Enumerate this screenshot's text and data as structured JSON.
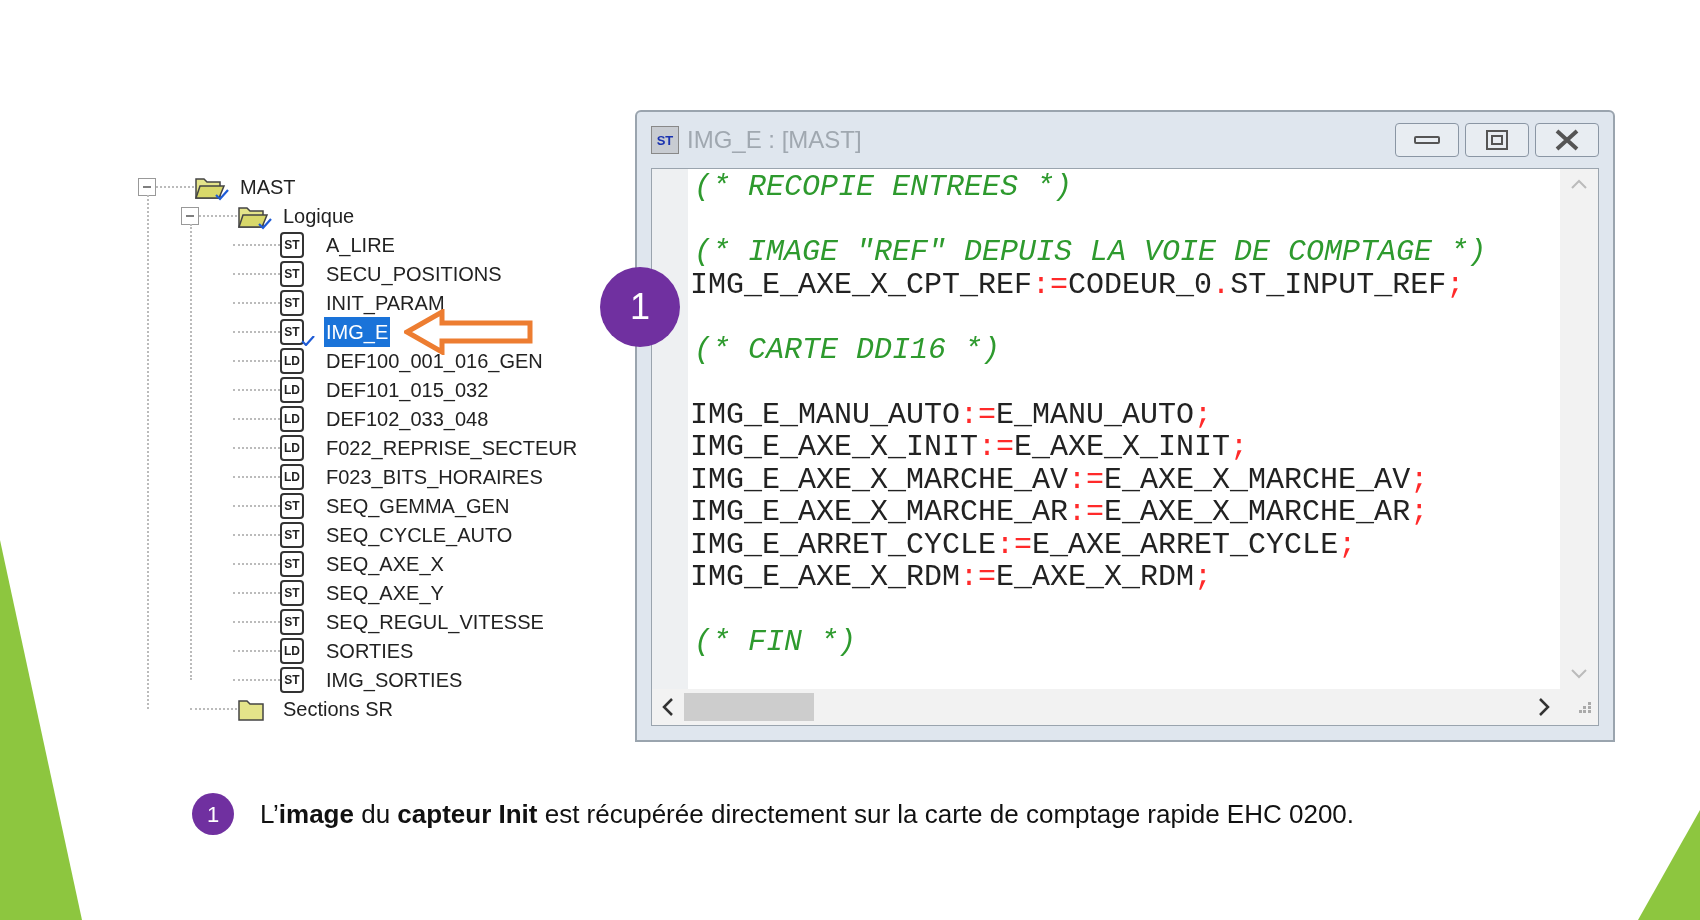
{
  "tree": [
    {
      "label": "MAST",
      "kind": "folder",
      "expanded": true,
      "marked": true,
      "selected": false,
      "children": [
        {
          "label": "Logique",
          "kind": "folder",
          "expanded": true,
          "marked": true,
          "selected": false,
          "children": [
            {
              "label": "A_LIRE",
              "kind": "section",
              "type": "ST",
              "marked": false,
              "selected": false
            },
            {
              "label": "SECU_POSITIONS",
              "kind": "section",
              "type": "ST",
              "marked": false,
              "selected": false
            },
            {
              "label": "INIT_PARAM",
              "kind": "section",
              "type": "ST",
              "marked": false,
              "selected": false
            },
            {
              "label": "IMG_E",
              "kind": "section",
              "type": "ST",
              "marked": true,
              "selected": true
            },
            {
              "label": "DEF100_001_016_GEN",
              "kind": "section",
              "type": "LD",
              "marked": false,
              "selected": false
            },
            {
              "label": "DEF101_015_032",
              "kind": "section",
              "type": "LD",
              "marked": false,
              "selected": false
            },
            {
              "label": "DEF102_033_048",
              "kind": "section",
              "type": "LD",
              "marked": false,
              "selected": false
            },
            {
              "label": "F022_REPRISE_SECTEUR",
              "kind": "section",
              "type": "LD",
              "marked": false,
              "selected": false
            },
            {
              "label": "F023_BITS_HORAIRES",
              "kind": "section",
              "type": "LD",
              "marked": false,
              "selected": false
            },
            {
              "label": "SEQ_GEMMA_GEN",
              "kind": "section",
              "type": "ST",
              "marked": false,
              "selected": false
            },
            {
              "label": "SEQ_CYCLE_AUTO",
              "kind": "section",
              "type": "ST",
              "marked": false,
              "selected": false
            },
            {
              "label": "SEQ_AXE_X",
              "kind": "section",
              "type": "ST",
              "marked": false,
              "selected": false
            },
            {
              "label": "SEQ_AXE_Y",
              "kind": "section",
              "type": "ST",
              "marked": false,
              "selected": false
            },
            {
              "label": "SEQ_REGUL_VITESSE",
              "kind": "section",
              "type": "ST",
              "marked": false,
              "selected": false
            },
            {
              "label": "SORTIES",
              "kind": "section",
              "type": "LD",
              "marked": false,
              "selected": false
            },
            {
              "label": "IMG_SORTIES",
              "kind": "section",
              "type": "ST",
              "marked": false,
              "selected": false
            }
          ]
        },
        {
          "label": "Sections SR",
          "kind": "folder",
          "expanded": false,
          "marked": false,
          "selected": false
        }
      ]
    }
  ],
  "window": {
    "icon": "ST",
    "title": "IMG_E : [MAST]",
    "lines": [
      {
        "kind": "comment",
        "text": "(* RECOPIE ENTREES *)"
      },
      {
        "kind": "blank"
      },
      {
        "kind": "comment",
        "text": "(* IMAGE \"REF\" DEPUIS LA VOIE DE COMPTAGE *)"
      },
      {
        "kind": "code",
        "parts": [
          {
            "kind": "ident",
            "text": "IMG_E_AXE_X_CPT_REF"
          },
          {
            "kind": "op",
            "text": ":="
          },
          {
            "kind": "ident",
            "text": "CODEUR_0"
          },
          {
            "kind": "op",
            "text": "."
          },
          {
            "kind": "ident",
            "text": "ST_INPUT_REF"
          },
          {
            "kind": "op",
            "text": ";"
          }
        ]
      },
      {
        "kind": "blank"
      },
      {
        "kind": "comment",
        "text": "(* CARTE DDI16 *)"
      },
      {
        "kind": "blank"
      },
      {
        "kind": "code",
        "parts": [
          {
            "kind": "ident",
            "text": "IMG_E_MANU_AUTO"
          },
          {
            "kind": "op",
            "text": ":="
          },
          {
            "kind": "ident",
            "text": "E_MANU_AUTO"
          },
          {
            "kind": "op",
            "text": ";"
          }
        ]
      },
      {
        "kind": "code",
        "parts": [
          {
            "kind": "ident",
            "text": "IMG_E_AXE_X_INIT"
          },
          {
            "kind": "op",
            "text": ":="
          },
          {
            "kind": "ident",
            "text": "E_AXE_X_INIT"
          },
          {
            "kind": "op",
            "text": ";"
          }
        ]
      },
      {
        "kind": "code",
        "parts": [
          {
            "kind": "ident",
            "text": "IMG_E_AXE_X_MARCHE_AV"
          },
          {
            "kind": "op",
            "text": ":="
          },
          {
            "kind": "ident",
            "text": "E_AXE_X_MARCHE_AV"
          },
          {
            "kind": "op",
            "text": ";"
          }
        ]
      },
      {
        "kind": "code",
        "parts": [
          {
            "kind": "ident",
            "text": "IMG_E_AXE_X_MARCHE_AR"
          },
          {
            "kind": "op",
            "text": ":="
          },
          {
            "kind": "ident",
            "text": "E_AXE_X_MARCHE_AR"
          },
          {
            "kind": "op",
            "text": ";"
          }
        ]
      },
      {
        "kind": "code",
        "parts": [
          {
            "kind": "ident",
            "text": "IMG_E_ARRET_CYCLE"
          },
          {
            "kind": "op",
            "text": ":="
          },
          {
            "kind": "ident",
            "text": "E_AXE_ARRET_CYCLE"
          },
          {
            "kind": "op",
            "text": ";"
          }
        ]
      },
      {
        "kind": "code",
        "parts": [
          {
            "kind": "ident",
            "text": "IMG_E_AXE_X_RDM"
          },
          {
            "kind": "op",
            "text": ":="
          },
          {
            "kind": "ident",
            "text": "E_AXE_X_RDM"
          },
          {
            "kind": "op",
            "text": ";"
          }
        ]
      },
      {
        "kind": "blank"
      },
      {
        "kind": "comment",
        "text": "(* FIN *)"
      }
    ]
  },
  "callout": {
    "number": "1"
  },
  "note": {
    "number": "1",
    "text": "L’**image** du **capteur Init** est récupérée directement sur la carte de comptage rapide EHC 0200."
  }
}
